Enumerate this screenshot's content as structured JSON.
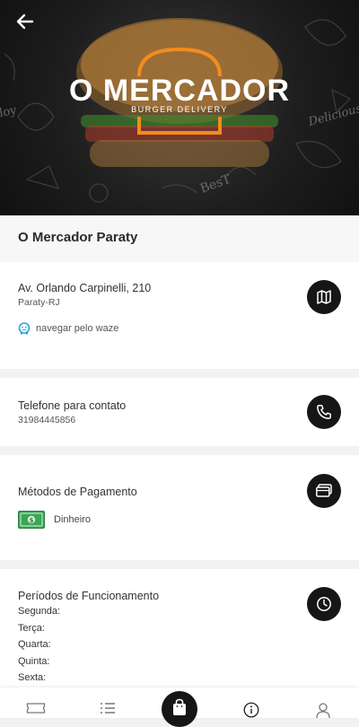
{
  "store": {
    "logo_text": "O MERCADOR",
    "logo_subtitle": "BURGER DELIVERY",
    "name": "O Mercador Paraty"
  },
  "address": {
    "street": "Av. Orlando Carpinelli, 210",
    "city": "Paraty-RJ",
    "waze_link": "navegar pelo waze",
    "icon": "map-icon"
  },
  "phone": {
    "label": "Telefone para contato",
    "number": "31984445856",
    "icon": "phone-icon"
  },
  "payment": {
    "label": "Métodos de Pagamento",
    "method": "Dinheiro",
    "icon": "wallet-icon"
  },
  "hours": {
    "label": "Períodos de Funcionamento",
    "days": [
      "Segunda:",
      "Terça:",
      "Quarta:",
      "Quinta:",
      "Sexta:"
    ],
    "icon": "clock-icon"
  },
  "bottom_nav": {
    "items": [
      "ticket-icon",
      "list-icon",
      "shopping-bag-icon",
      "info-icon",
      "user-icon"
    ]
  },
  "colors": {
    "accent": "#f28c1e",
    "dark": "#161616",
    "cash_green": "#3aa655"
  }
}
